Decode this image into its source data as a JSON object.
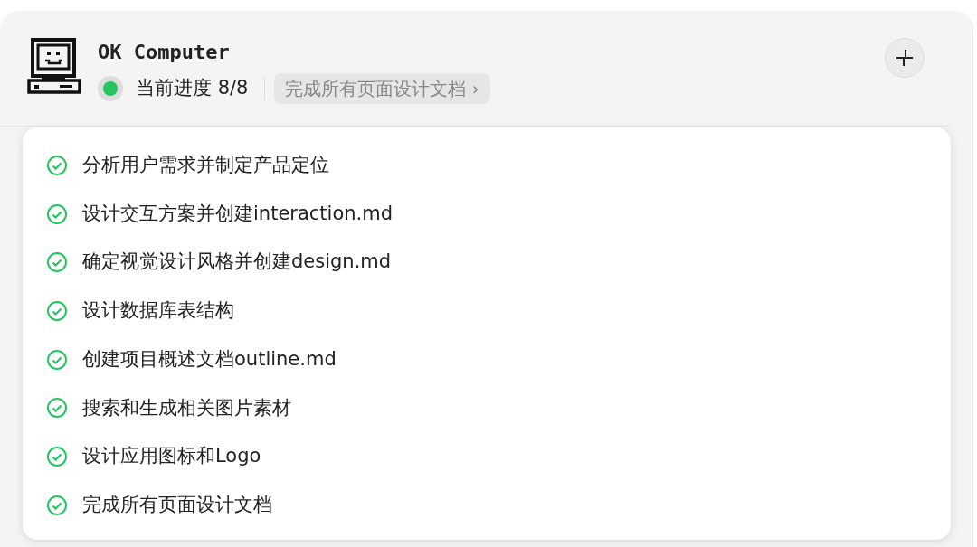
{
  "header": {
    "title": "OK Computer",
    "status": {
      "active": true,
      "label": "当前进度 8/8"
    },
    "current_task": "完成所有页面设计文档",
    "chevron": "›"
  },
  "tasks": [
    {
      "label": "分析用户需求并制定产品定位",
      "done": true
    },
    {
      "label": "设计交互方案并创建interaction.md",
      "done": true
    },
    {
      "label": "确定视觉设计风格并创建design.md",
      "done": true
    },
    {
      "label": "设计数据库表结构",
      "done": true
    },
    {
      "label": "创建项目概述文档outline.md",
      "done": true
    },
    {
      "label": "搜索和生成相关图片素材",
      "done": true
    },
    {
      "label": "设计应用图标和Logo",
      "done": true
    },
    {
      "label": "完成所有页面设计文档",
      "done": true
    }
  ]
}
